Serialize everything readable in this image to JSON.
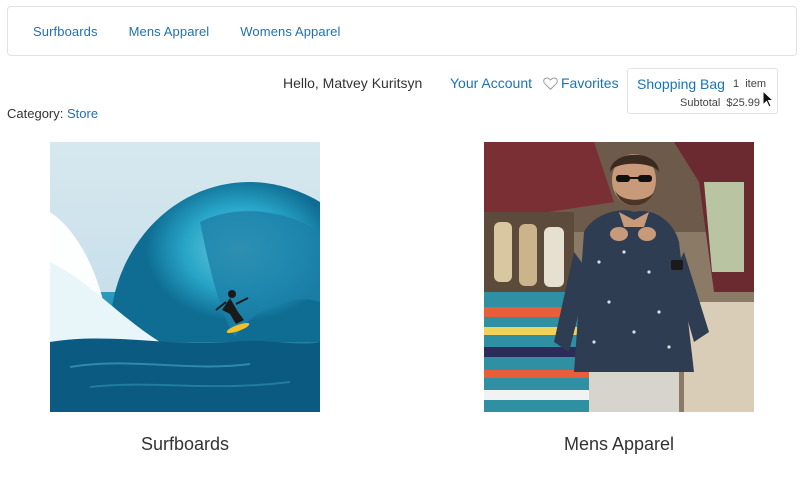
{
  "nav": {
    "items": [
      "Surfboards",
      "Mens Apparel",
      "Womens Apparel"
    ]
  },
  "account": {
    "greeting": "Hello, Matvey Kuritsyn",
    "account_link": "Your Account",
    "favorites": "Favorites"
  },
  "bag": {
    "title": "Shopping Bag",
    "count": "1  item",
    "subtotal_label": "Subtotal",
    "subtotal_value": "$25.99"
  },
  "category": {
    "label": "Category:",
    "value": "Store"
  },
  "tiles": [
    {
      "caption": "Surfboards"
    },
    {
      "caption": "Mens Apparel"
    }
  ],
  "colors": {
    "link": "#1a73b8",
    "text": "#333333",
    "border": "#e2e2e2"
  },
  "icons": [
    "heart-outline-icon",
    "mouse-cursor-icon"
  ]
}
